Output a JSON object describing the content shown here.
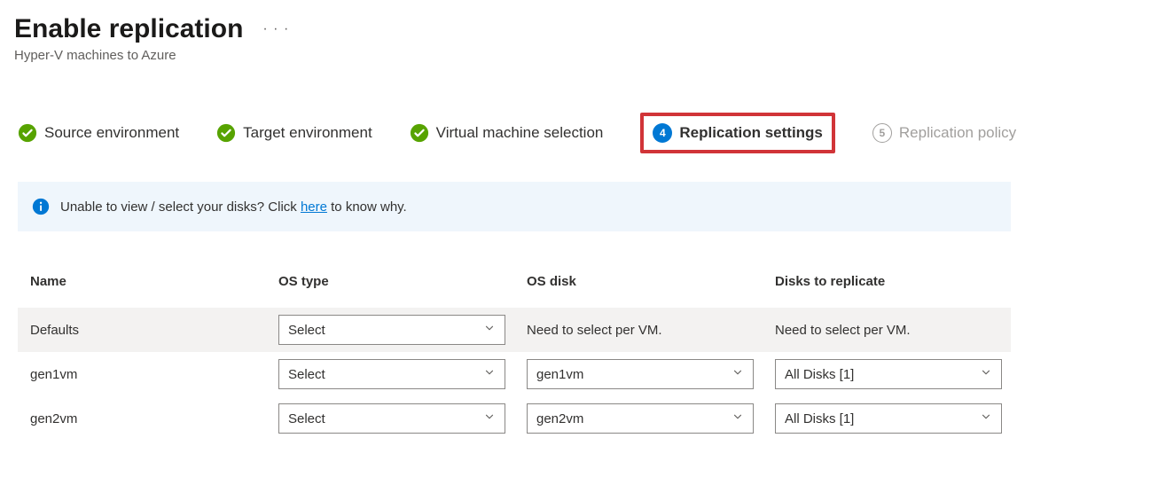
{
  "header": {
    "title": "Enable replication",
    "subtitle": "Hyper-V machines to Azure"
  },
  "steps": [
    {
      "label": "Source environment",
      "state": "done"
    },
    {
      "label": "Target environment",
      "state": "done"
    },
    {
      "label": "Virtual machine selection",
      "state": "done"
    },
    {
      "label": "Replication settings",
      "state": "active",
      "num": "4"
    },
    {
      "label": "Replication policy",
      "state": "future",
      "num": "5"
    }
  ],
  "banner": {
    "text_before": "Unable to view / select your disks? Click ",
    "link": "here",
    "text_after": " to know why."
  },
  "table": {
    "columns": [
      "Name",
      "OS type",
      "OS disk",
      "Disks to replicate"
    ],
    "rows": [
      {
        "name": "Defaults",
        "os_type": "Select",
        "os_disk_text": "Need to select per VM.",
        "disks_text": "Need to select per VM."
      },
      {
        "name": "gen1vm",
        "os_type": "Select",
        "os_disk": "gen1vm",
        "disks": "All Disks [1]"
      },
      {
        "name": "gen2vm",
        "os_type": "Select",
        "os_disk": "gen2vm",
        "disks": "All Disks [1]"
      }
    ]
  }
}
